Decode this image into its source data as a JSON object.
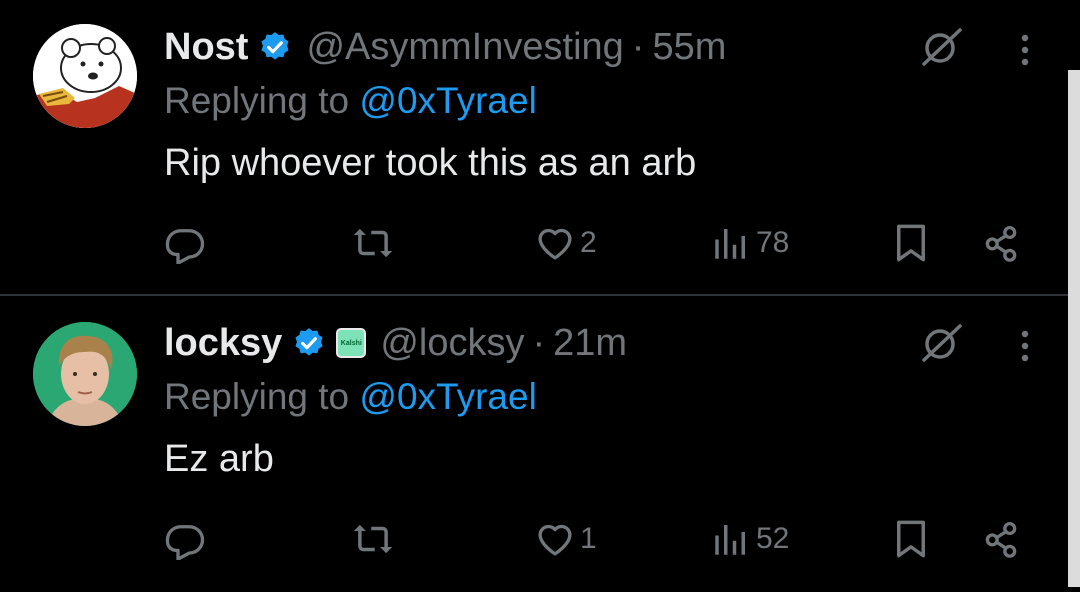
{
  "tweets": [
    {
      "name": "Nost",
      "handle": "@AsymmInvesting",
      "separator": "·",
      "time": "55m",
      "replying_prefix": "Replying to",
      "replying_to": "@0xTyrael",
      "text": "Rip whoever took this as an arb",
      "likes": "2",
      "views": "78",
      "avatar": "cartoon-bear-avatar"
    },
    {
      "name": "locksy",
      "affiliate_badge": "Kalshi",
      "handle": "@locksy",
      "separator": "·",
      "time": "21m",
      "replying_prefix": "Replying to",
      "replying_to": "@0xTyrael",
      "text": "Ez arb",
      "likes": "1",
      "views": "52",
      "avatar": "person-photo-avatar"
    }
  ],
  "colors": {
    "background": "#000000",
    "text": "#e7e9ea",
    "muted": "#71767b",
    "accent": "#1d9bf0",
    "divider": "#2f3336"
  }
}
